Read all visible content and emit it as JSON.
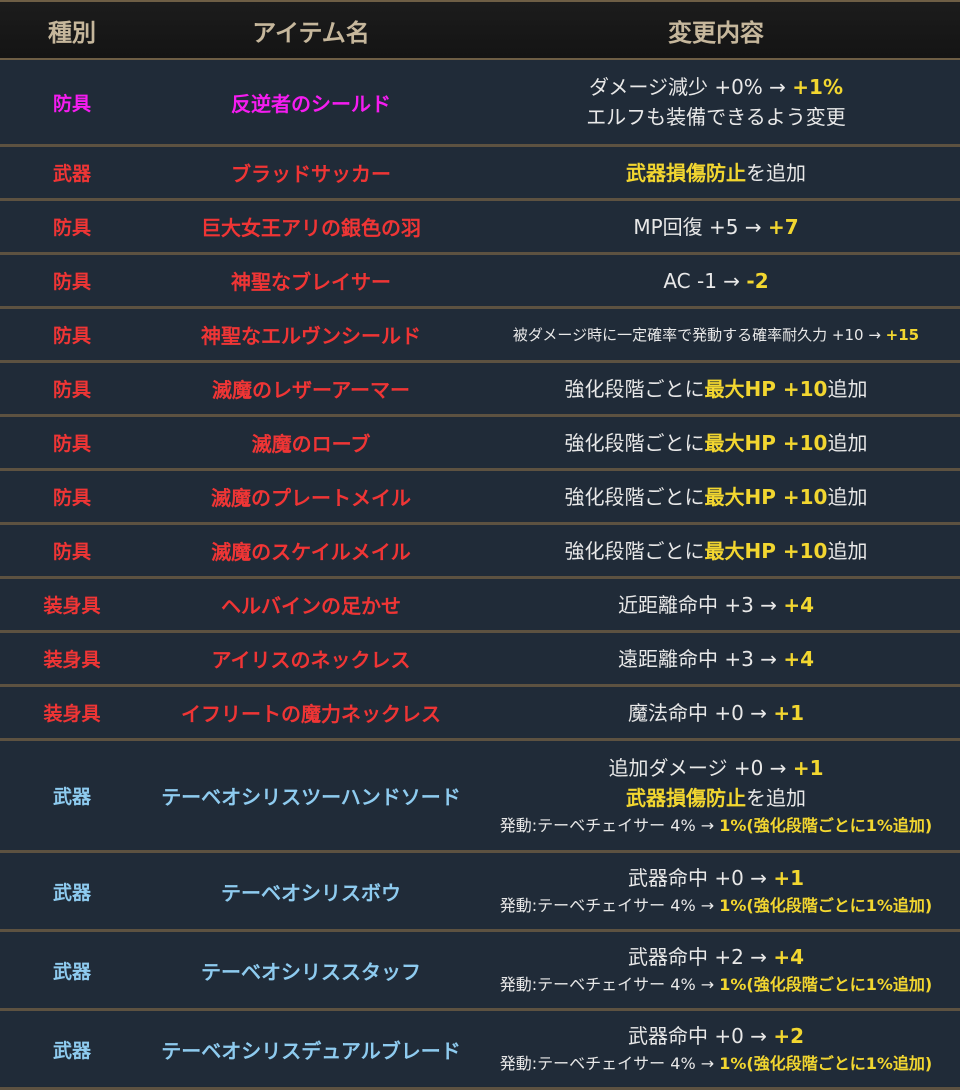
{
  "header": {
    "type": "種別",
    "name": "アイテム名",
    "change": "変更内容"
  },
  "colors": {
    "magenta": "#f51cf0",
    "red": "#ef3535",
    "blue": "#8ecbef",
    "highlight": "#f2d630",
    "text": "#e8e8e8"
  },
  "rows": [
    {
      "type": "防具",
      "name": "反逆者のシールド",
      "color": "magenta",
      "height": 87,
      "lines": [
        {
          "size": "normal",
          "parts": [
            {
              "t": "ダメージ減少 +0% → "
            },
            {
              "t": "+1%",
              "h": true
            }
          ]
        },
        {
          "size": "normal",
          "parts": [
            {
              "t": "エルフも装備できるよう変更"
            }
          ]
        }
      ]
    },
    {
      "type": "武器",
      "name": "ブラッドサッカー",
      "color": "red",
      "height": 54,
      "lines": [
        {
          "size": "normal",
          "parts": [
            {
              "t": "武器損傷防止",
              "h": true
            },
            {
              "t": "を追加"
            }
          ]
        }
      ]
    },
    {
      "type": "防具",
      "name": "巨大女王アリの銀色の羽",
      "color": "red",
      "height": 54,
      "lines": [
        {
          "size": "normal",
          "parts": [
            {
              "t": "MP回復 +5 → "
            },
            {
              "t": "+7",
              "h": true
            }
          ]
        }
      ]
    },
    {
      "type": "防具",
      "name": "神聖なブレイサー",
      "color": "red",
      "height": 54,
      "lines": [
        {
          "size": "normal",
          "parts": [
            {
              "t": "AC -1 → "
            },
            {
              "t": "-2",
              "h": true
            }
          ]
        }
      ]
    },
    {
      "type": "防具",
      "name": "神聖なエルヴンシールド",
      "color": "red",
      "height": 54,
      "lines": [
        {
          "size": "xs",
          "parts": [
            {
              "t": "被ダメージ時に一定確率で発動する確率耐久力 +10 → "
            },
            {
              "t": "+15",
              "h": true
            }
          ]
        }
      ]
    },
    {
      "type": "防具",
      "name": "滅魔のレザーアーマー",
      "color": "red",
      "height": 54,
      "lines": [
        {
          "size": "normal",
          "parts": [
            {
              "t": "強化段階ごとに"
            },
            {
              "t": "最大HP +10",
              "h": true
            },
            {
              "t": "追加"
            }
          ]
        }
      ]
    },
    {
      "type": "防具",
      "name": "滅魔のローブ",
      "color": "red",
      "height": 54,
      "lines": [
        {
          "size": "normal",
          "parts": [
            {
              "t": "強化段階ごとに"
            },
            {
              "t": "最大HP +10",
              "h": true
            },
            {
              "t": "追加"
            }
          ]
        }
      ]
    },
    {
      "type": "防具",
      "name": "滅魔のプレートメイル",
      "color": "red",
      "height": 54,
      "lines": [
        {
          "size": "normal",
          "parts": [
            {
              "t": "強化段階ごとに"
            },
            {
              "t": "最大HP +10",
              "h": true
            },
            {
              "t": "追加"
            }
          ]
        }
      ]
    },
    {
      "type": "防具",
      "name": "滅魔のスケイルメイル",
      "color": "red",
      "height": 54,
      "lines": [
        {
          "size": "normal",
          "parts": [
            {
              "t": "強化段階ごとに"
            },
            {
              "t": "最大HP +10",
              "h": true
            },
            {
              "t": "追加"
            }
          ]
        }
      ]
    },
    {
      "type": "装身具",
      "name": "ヘルバインの足かせ",
      "color": "red",
      "height": 54,
      "lines": [
        {
          "size": "normal",
          "parts": [
            {
              "t": "近距離命中 +3 → "
            },
            {
              "t": "+4",
              "h": true
            }
          ]
        }
      ]
    },
    {
      "type": "装身具",
      "name": "アイリスのネックレス",
      "color": "red",
      "height": 54,
      "lines": [
        {
          "size": "normal",
          "parts": [
            {
              "t": "遠距離命中 +3 → "
            },
            {
              "t": "+4",
              "h": true
            }
          ]
        }
      ]
    },
    {
      "type": "装身具",
      "name": "イフリートの魔力ネックレス",
      "color": "red",
      "height": 54,
      "lines": [
        {
          "size": "normal",
          "parts": [
            {
              "t": "魔法命中 +0 → "
            },
            {
              "t": "+1",
              "h": true
            }
          ]
        }
      ]
    },
    {
      "type": "武器",
      "name": "テーベオシリスツーハンドソード",
      "color": "blue",
      "height": 112,
      "lines": [
        {
          "size": "normal",
          "parts": [
            {
              "t": "追加ダメージ +0 → "
            },
            {
              "t": "+1",
              "h": true
            }
          ]
        },
        {
          "size": "normal",
          "parts": [
            {
              "t": "武器損傷防止",
              "h": true
            },
            {
              "t": "を追加"
            }
          ]
        },
        {
          "size": "small",
          "parts": [
            {
              "t": "発動:テーベチェイサー 4% → "
            },
            {
              "t": "1%(強化段階ごとに1%追加)",
              "h": true
            }
          ]
        }
      ]
    },
    {
      "type": "武器",
      "name": "テーベオシリスボウ",
      "color": "blue",
      "height": 79,
      "lines": [
        {
          "size": "normal",
          "parts": [
            {
              "t": "武器命中 +0 → "
            },
            {
              "t": "+1",
              "h": true
            }
          ]
        },
        {
          "size": "small",
          "parts": [
            {
              "t": "発動:テーベチェイサー 4% → "
            },
            {
              "t": "1%(強化段階ごとに1%追加)",
              "h": true
            }
          ]
        }
      ]
    },
    {
      "type": "武器",
      "name": "テーベオシリススタッフ",
      "color": "blue",
      "height": 79,
      "lines": [
        {
          "size": "normal",
          "parts": [
            {
              "t": "武器命中 +2 → "
            },
            {
              "t": "+4",
              "h": true
            }
          ]
        },
        {
          "size": "small",
          "parts": [
            {
              "t": "発動:テーベチェイサー 4% → "
            },
            {
              "t": "1%(強化段階ごとに1%追加)",
              "h": true
            }
          ]
        }
      ]
    },
    {
      "type": "武器",
      "name": "テーベオシリスデュアルブレード",
      "color": "blue",
      "height": 79,
      "lines": [
        {
          "size": "normal",
          "parts": [
            {
              "t": "武器命中 +0 → "
            },
            {
              "t": "+2",
              "h": true
            }
          ]
        },
        {
          "size": "small",
          "parts": [
            {
              "t": "発動:テーベチェイサー 4% → "
            },
            {
              "t": "1%(強化段階ごとに1%追加)",
              "h": true
            }
          ]
        }
      ]
    }
  ]
}
